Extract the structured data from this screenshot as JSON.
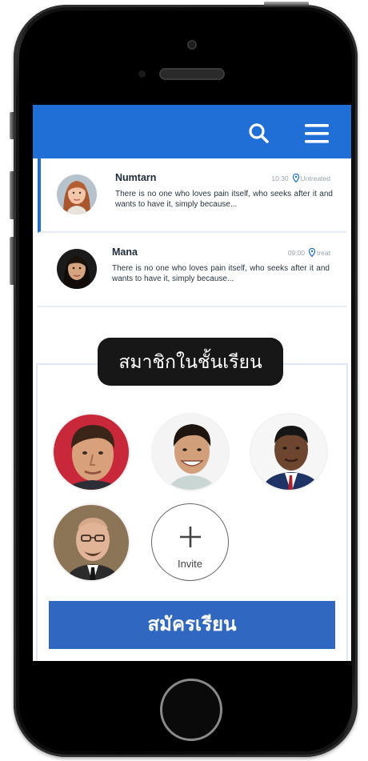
{
  "header": {
    "background_color": "#1f6fd6",
    "search_icon": "search-icon",
    "menu_icon": "hamburger-menu-icon"
  },
  "messages": [
    {
      "name": "Numtarn",
      "time": "10:30",
      "status": "Untreated",
      "preview": "There is no one who loves pain itself, who seeks after it and wants to have it, simply because...",
      "selected": true
    },
    {
      "name": "Mana",
      "time": "09:00",
      "status": "treat",
      "preview": "There is no one who loves pain itself, who seeks after it and wants to have it, simply because...",
      "selected": false
    }
  ],
  "members": {
    "title": "สมาชิกในชั้นเรียน",
    "invite_label": "Invite",
    "invite_icon": "plus-icon"
  },
  "enroll": {
    "label": "สมัครเรียน",
    "color": "#3067c0"
  }
}
